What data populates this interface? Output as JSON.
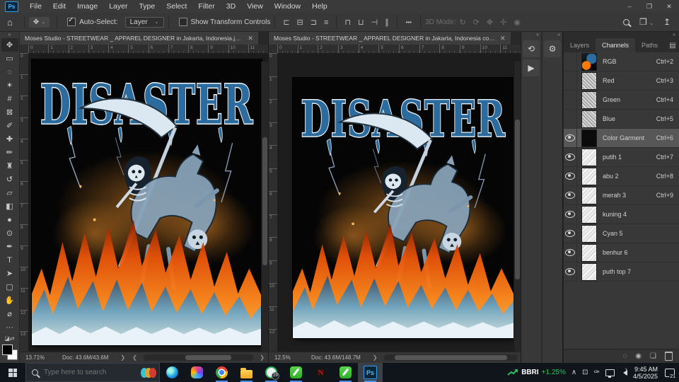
{
  "window": {
    "controls": [
      {
        "name": "minimize-button",
        "glyph": "–"
      },
      {
        "name": "restore-button",
        "glyph": "❐"
      },
      {
        "name": "close-button",
        "glyph": "✕"
      }
    ]
  },
  "menu_bar": {
    "items": [
      {
        "id": "menu-file",
        "label": "File"
      },
      {
        "id": "menu-edit",
        "label": "Edit"
      },
      {
        "id": "menu-image",
        "label": "Image"
      },
      {
        "id": "menu-layer",
        "label": "Layer"
      },
      {
        "id": "menu-type",
        "label": "Type"
      },
      {
        "id": "menu-select",
        "label": "Select"
      },
      {
        "id": "menu-filter",
        "label": "Filter"
      },
      {
        "id": "menu-3d",
        "label": "3D"
      },
      {
        "id": "menu-view",
        "label": "View"
      },
      {
        "id": "menu-window",
        "label": "Window"
      },
      {
        "id": "menu-help",
        "label": "Help"
      }
    ],
    "logo_text": "Ps"
  },
  "options_bar": {
    "move_tool_glyph": "✥",
    "auto_select_label": "Auto-Select:",
    "layer_dropdown_value": "Layer",
    "show_transform_label": "Show Transform Controls",
    "align_icons": [
      {
        "name": "align-left-icon",
        "glyph": "⊏"
      },
      {
        "name": "align-center-h-icon",
        "glyph": "⊟"
      },
      {
        "name": "align-right-icon",
        "glyph": "⊐"
      },
      {
        "name": "align-center-icon",
        "glyph": "≡"
      }
    ],
    "distribute_icons": [
      {
        "name": "align-top-icon",
        "glyph": "⊓"
      },
      {
        "name": "align-middle-icon",
        "glyph": "⊔"
      },
      {
        "name": "align-bottom-icon",
        "glyph": "⊣"
      },
      {
        "name": "distribute-icon",
        "glyph": "∥"
      }
    ],
    "overflow_label": "•••",
    "mode_3d_label": "3D Mode:",
    "mode_3d_icons": [
      {
        "name": "3d-orbit-icon",
        "glyph": "↻"
      },
      {
        "name": "3d-roll-icon",
        "glyph": "⟳"
      },
      {
        "name": "3d-pan-icon",
        "glyph": "✥"
      },
      {
        "name": "3d-slide-icon",
        "glyph": "✢"
      },
      {
        "name": "3d-camera-icon",
        "glyph": "◉"
      }
    ],
    "workspace_glyph": "❒",
    "share_glyph": "↥"
  },
  "toolbar": {
    "tools": [
      {
        "name": "move-tool",
        "glyph": "✥",
        "selected": true
      },
      {
        "name": "marquee-tool",
        "glyph": "▭"
      },
      {
        "name": "lasso-tool",
        "glyph": "◌"
      },
      {
        "name": "magic-wand-tool",
        "glyph": "✶"
      },
      {
        "name": "crop-tool",
        "glyph": "#"
      },
      {
        "name": "frame-tool",
        "glyph": "⊠"
      },
      {
        "name": "eyedropper-tool",
        "glyph": "✐"
      },
      {
        "name": "healing-brush-tool",
        "glyph": "✚"
      },
      {
        "name": "brush-tool",
        "glyph": "✏"
      },
      {
        "name": "clone-stamp-tool",
        "glyph": "♜"
      },
      {
        "name": "history-brush-tool",
        "glyph": "↺"
      },
      {
        "name": "eraser-tool",
        "glyph": "▱"
      },
      {
        "name": "gradient-tool",
        "glyph": "◧"
      },
      {
        "name": "blur-tool",
        "glyph": "●"
      },
      {
        "name": "dodge-tool",
        "glyph": "⊙"
      },
      {
        "name": "pen-tool",
        "glyph": "✒"
      },
      {
        "name": "type-tool",
        "glyph": "T"
      },
      {
        "name": "path-selection-tool",
        "glyph": "➤"
      },
      {
        "name": "shape-tool",
        "glyph": "▢"
      },
      {
        "name": "hand-tool",
        "glyph": "✋"
      },
      {
        "name": "zoom-tool",
        "glyph": "⌀"
      },
      {
        "name": "toolbar-more",
        "glyph": "···"
      }
    ]
  },
  "documents": [
    {
      "tab_title": "Moses Studio - STREETWEAR _ APPAREL  DESIGNER in Jakarta, Indonesia.jpg @ ...",
      "zoom_level": "13.71%",
      "doc_size": "Doc: 43.6M/43.6M",
      "ruler_top": [
        "0",
        "1",
        "2",
        "3",
        "4",
        "5",
        "6",
        "7",
        "8",
        "9",
        "10",
        "11"
      ],
      "ruler_left": [
        "0",
        "1",
        "2",
        "3",
        "4",
        "5",
        "6",
        "7",
        "8",
        "9",
        "10",
        "11",
        "12",
        "13"
      ]
    },
    {
      "tab_title": "Moses Studio - STREETWEAR _ APPAREL  DESIGNER in Jakarta, Indonesia copy ...",
      "zoom_level": "12.5%",
      "doc_size": "Doc: 43.6M/148.7M",
      "ruler_top": [
        "0",
        "1",
        "2",
        "3",
        "4",
        "5",
        "6",
        "7",
        "8",
        "9",
        "10",
        "11"
      ],
      "ruler_left": [
        "0",
        "1",
        "2",
        "3",
        "4",
        "5",
        "6",
        "7",
        "8",
        "9",
        "10",
        "11",
        "12"
      ]
    }
  ],
  "artwork": {
    "title_text": "DISASTER",
    "title_color": "#2c6b9e",
    "flame_orange": "#ff8a1e",
    "flame_blue": "#5aa7d6",
    "description": "Grim reaper skeleton riding a skeletal horse over orange and blue flames on black garment"
  },
  "side_strip": {
    "col1": [
      {
        "name": "history-panel-icon",
        "glyph": "⟲"
      },
      {
        "name": "actions-panel-icon",
        "glyph": "▶"
      }
    ],
    "col2": [
      {
        "name": "properties-panel-icon",
        "glyph": "⚙"
      }
    ]
  },
  "panels": {
    "tabs": [
      {
        "label": "Layers",
        "active": false
      },
      {
        "label": "Channels",
        "active": true
      },
      {
        "label": "Paths",
        "active": false
      }
    ],
    "channels": [
      {
        "name": "RGB",
        "shortcut": "Ctrl+2",
        "eye": false,
        "thumb": "rgb",
        "selected": false
      },
      {
        "name": "Red",
        "shortcut": "Ctrl+3",
        "eye": false,
        "thumb": "gray",
        "selected": false
      },
      {
        "name": "Green",
        "shortcut": "Ctrl+4",
        "eye": false,
        "thumb": "gray",
        "selected": false
      },
      {
        "name": "Blue",
        "shortcut": "Ctrl+5",
        "eye": false,
        "thumb": "gray",
        "selected": false
      },
      {
        "name": "Color Garment",
        "shortcut": "Ctrl+6",
        "eye": true,
        "thumb": "black",
        "selected": true
      },
      {
        "name": "putih 1",
        "shortcut": "Ctrl+7",
        "eye": true,
        "thumb": "spot",
        "selected": false
      },
      {
        "name": "abu 2",
        "shortcut": "Ctrl+8",
        "eye": true,
        "thumb": "spot",
        "selected": false
      },
      {
        "name": "merah 3",
        "shortcut": "Ctrl+9",
        "eye": true,
        "thumb": "spot",
        "selected": false
      },
      {
        "name": "kuning 4",
        "shortcut": "",
        "eye": true,
        "thumb": "spot",
        "selected": false
      },
      {
        "name": "Cyan 5",
        "shortcut": "",
        "eye": true,
        "thumb": "spot",
        "selected": false
      },
      {
        "name": "benhur 6",
        "shortcut": "",
        "eye": true,
        "thumb": "spot",
        "selected": false
      },
      {
        "name": "puth top 7",
        "shortcut": "",
        "eye": true,
        "thumb": "spot",
        "selected": false
      }
    ],
    "footer_icons": {
      "load": "◌",
      "save": "◉",
      "new": "❏"
    }
  },
  "taskbar": {
    "search_placeholder": "Type here to search",
    "app_icons": [
      {
        "name": "edge-icon",
        "kind": "edge",
        "running": false,
        "label": "",
        "badge": ""
      },
      {
        "name": "microsoft-365-icon",
        "kind": "m365",
        "running": false,
        "label": "",
        "badge": ""
      },
      {
        "name": "chrome-icon",
        "kind": "chrome",
        "running": true,
        "label": "",
        "badge": ""
      },
      {
        "name": "file-explorer-icon",
        "kind": "folder",
        "running": true,
        "label": "",
        "badge": ""
      },
      {
        "name": "screen-recorder-icon",
        "kind": "recorder",
        "running": true,
        "label": "",
        "badge": "29"
      },
      {
        "name": "green-app-icon",
        "kind": "greenapp",
        "running": true,
        "label": "",
        "badge": ""
      },
      {
        "name": "netflix-icon",
        "kind": "netflix",
        "running": false,
        "label": "N",
        "badge": ""
      },
      {
        "name": "green-app-2-icon",
        "kind": "greenapp",
        "running": true,
        "label": "",
        "badge": ""
      },
      {
        "name": "photoshop-icon",
        "kind": "ps",
        "running": true,
        "active": true,
        "label": "Ps",
        "badge": ""
      }
    ],
    "stock": {
      "symbol": "BBRI",
      "change": "+1.25%"
    },
    "clock": {
      "time": "9:45 AM",
      "date": "4/5/2025"
    },
    "notification_count": "21"
  }
}
